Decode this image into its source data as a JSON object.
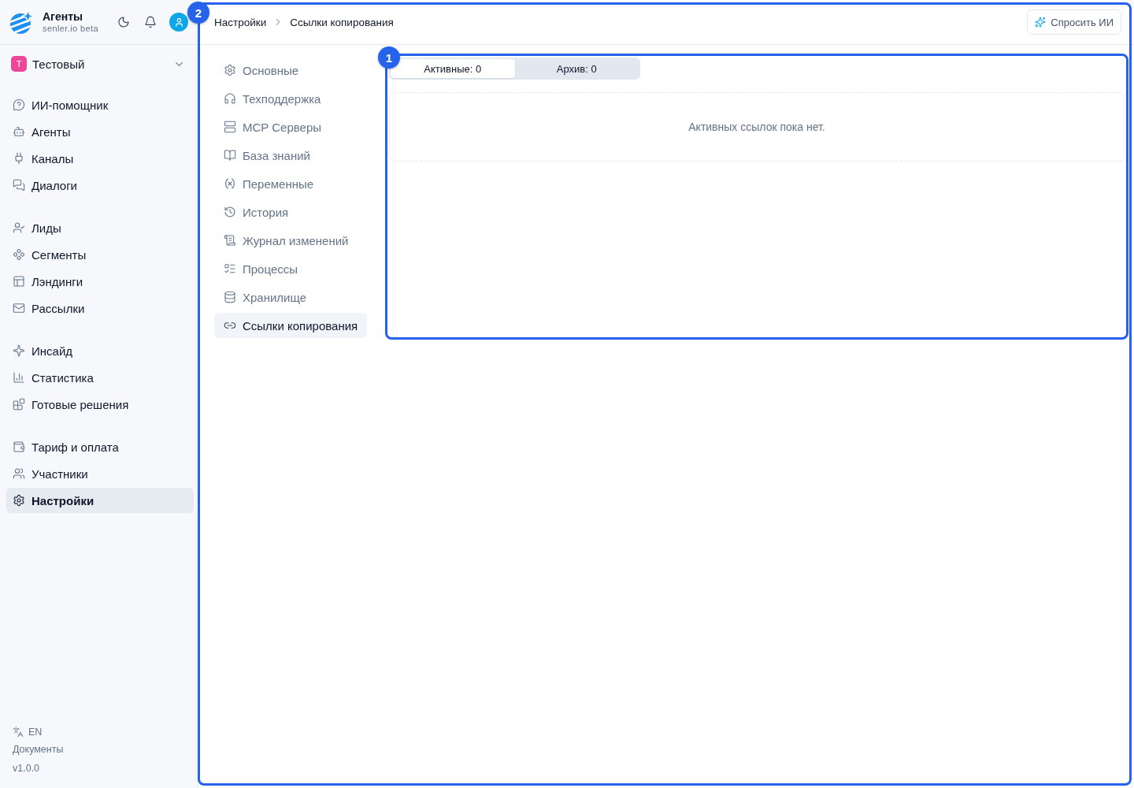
{
  "sidebar": {
    "brand": {
      "title": "Агенты",
      "subtitle": "senler.io beta"
    },
    "workspace": {
      "initial": "Т",
      "name": "Тестовый"
    },
    "nav_groups": [
      {
        "items": [
          {
            "label": "ИИ-помощник",
            "selected": false
          },
          {
            "label": "Агенты",
            "selected": false
          },
          {
            "label": "Каналы",
            "selected": false
          },
          {
            "label": "Диалоги",
            "selected": false
          }
        ]
      },
      {
        "items": [
          {
            "label": "Лиды",
            "selected": false
          },
          {
            "label": "Сегменты",
            "selected": false
          },
          {
            "label": "Лэндинги",
            "selected": false
          },
          {
            "label": "Рассылки",
            "selected": false
          }
        ]
      },
      {
        "items": [
          {
            "label": "Инсайд",
            "selected": false
          },
          {
            "label": "Статистика",
            "selected": false
          },
          {
            "label": "Готовые решения",
            "selected": false
          }
        ]
      },
      {
        "items": [
          {
            "label": "Тариф и оплата",
            "selected": false
          },
          {
            "label": "Участники",
            "selected": false
          },
          {
            "label": "Настройки",
            "selected": true
          }
        ]
      }
    ],
    "footer": {
      "language": "EN",
      "docs": "Документы",
      "version": "v1.0.0"
    }
  },
  "main": {
    "annotation": "2",
    "breadcrumb": [
      "Настройки",
      "Ссылки копирования"
    ],
    "ask_ai_button": "Спросить ИИ",
    "settings_nav": [
      {
        "label": "Основные",
        "selected": false
      },
      {
        "label": "Техподдержка",
        "selected": false
      },
      {
        "label": "MCP Серверы",
        "selected": false
      },
      {
        "label": "База знаний",
        "selected": false
      },
      {
        "label": "Переменные",
        "selected": false
      },
      {
        "label": "История",
        "selected": false
      },
      {
        "label": "Журнал изменений",
        "selected": false
      },
      {
        "label": "Процессы",
        "selected": false
      },
      {
        "label": "Хранилище",
        "selected": false
      },
      {
        "label": "Ссылки копирования",
        "selected": true
      }
    ],
    "links_panel": {
      "annotation": "1",
      "tabs": [
        {
          "label": "Активные: 0",
          "selected": true
        },
        {
          "label": "Архив: 0",
          "selected": false
        }
      ],
      "empty_message": "Активных ссылок пока нет."
    }
  }
}
